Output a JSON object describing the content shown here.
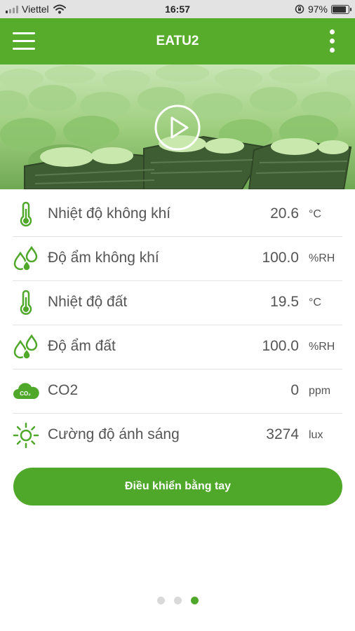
{
  "status_bar": {
    "carrier": "Viettel",
    "time": "16:57",
    "battery": "97%",
    "battery_level": 0.97
  },
  "header": {
    "title": "EATU2",
    "menu_icon": "hamburger-menu-icon",
    "more_icon": "more-vertical-icon"
  },
  "hero": {
    "image": "lettuce-field-photo",
    "play_icon": "play-icon"
  },
  "sensors": [
    {
      "icon": "thermometer-icon",
      "label": "Nhiệt độ không khí",
      "value": "20.6",
      "unit": "°C"
    },
    {
      "icon": "droplets-icon",
      "label": "Độ ẩm không khí",
      "value": "100.0",
      "unit": "%RH"
    },
    {
      "icon": "thermometer-icon",
      "label": "Nhiệt độ đất",
      "value": "19.5",
      "unit": "°C"
    },
    {
      "icon": "droplets-icon",
      "label": "Độ ẩm đất",
      "value": "100.0",
      "unit": "%RH"
    },
    {
      "icon": "co2-cloud-icon",
      "label": "CO2",
      "value": "0",
      "unit": "ppm",
      "icon_text": "CO₂"
    },
    {
      "icon": "sun-icon",
      "label": "Cường độ ánh sáng",
      "value": "3274",
      "unit": "lux"
    }
  ],
  "manual_control": {
    "label": "Điều khiển bằng tay"
  },
  "pager": {
    "count": 3,
    "active": 3
  },
  "colors": {
    "primary": "#57ad2b",
    "button": "#4fa82a",
    "text": "#555555",
    "divider": "#e3e3e3"
  }
}
